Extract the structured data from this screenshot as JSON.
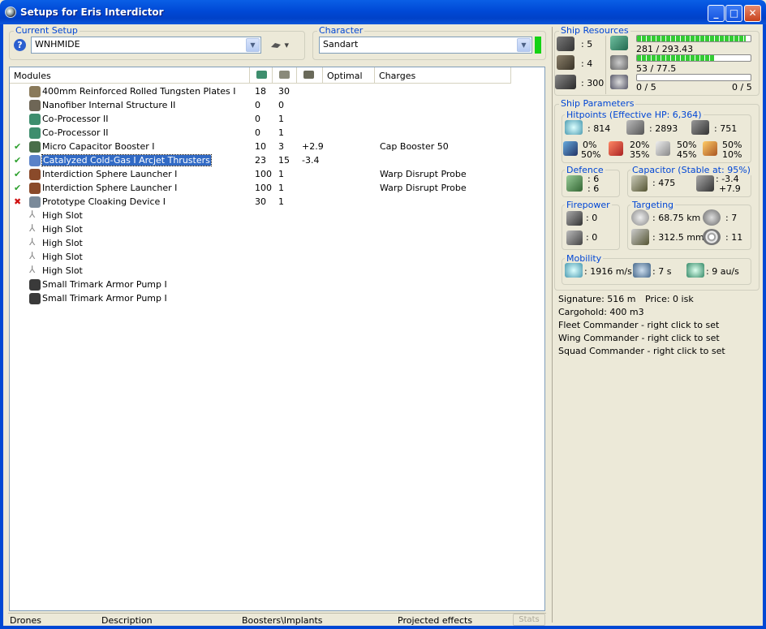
{
  "window": {
    "title": "Setups for Eris Interdictor",
    "buttons": {
      "minimize": "_",
      "maximize": "□",
      "close": "✕"
    }
  },
  "current_setup": {
    "caption": "Current Setup",
    "value": "WNHMIDE",
    "ship_menu_label": "▾"
  },
  "character": {
    "caption": "Character",
    "value": "Sandart",
    "status_color": "#14D214"
  },
  "modules_table": {
    "headers": {
      "modules": "Modules",
      "optimal": "Optimal",
      "charges": "Charges"
    },
    "rows": [
      {
        "status": "",
        "name": "400mm Reinforced Rolled Tungsten Plates I",
        "cpu": "18",
        "pg": "30",
        "cap": "",
        "charge": "",
        "color": "#8A7A5A"
      },
      {
        "status": "",
        "name": "Nanofiber Internal Structure II",
        "cpu": "0",
        "pg": "0",
        "cap": "",
        "charge": "",
        "color": "#6E6656"
      },
      {
        "status": "",
        "name": "Co-Processor II",
        "cpu": "0",
        "pg": "1",
        "cap": "",
        "charge": "",
        "color": "#3E8E6E"
      },
      {
        "status": "",
        "name": "Co-Processor II",
        "cpu": "0",
        "pg": "1",
        "cap": "",
        "charge": "",
        "color": "#3E8E6E"
      },
      {
        "status": "✔",
        "name": "Micro Capacitor Booster I",
        "cpu": "10",
        "pg": "3",
        "cap": "+2.9",
        "charge": "Cap Booster 50",
        "color": "#4A6E4A"
      },
      {
        "status": "✔",
        "name": "Catalyzed Cold-Gas I Arcjet Thrusters",
        "cpu": "23",
        "pg": "15",
        "cap": "-3.4",
        "charge": "",
        "color": "#5A82C8",
        "selected": true
      },
      {
        "status": "✔",
        "name": "Interdiction Sphere Launcher I",
        "cpu": "100",
        "pg": "1",
        "cap": "",
        "charge": "Warp Disrupt Probe",
        "color": "#8A4A2A"
      },
      {
        "status": "✔",
        "name": "Interdiction Sphere Launcher I",
        "cpu": "100",
        "pg": "1",
        "cap": "",
        "charge": "Warp Disrupt Probe",
        "color": "#8A4A2A"
      },
      {
        "status": "✖",
        "name": "Prototype Cloaking Device I",
        "cpu": "30",
        "pg": "1",
        "cap": "",
        "charge": "",
        "color": "#7A8A9A"
      },
      {
        "status": "",
        "name": "High Slot",
        "cpu": "",
        "pg": "",
        "cap": "",
        "charge": "",
        "color": "#B0B0B0",
        "empty": true
      },
      {
        "status": "",
        "name": "High Slot",
        "cpu": "",
        "pg": "",
        "cap": "",
        "charge": "",
        "color": "#B0B0B0",
        "empty": true
      },
      {
        "status": "",
        "name": "High Slot",
        "cpu": "",
        "pg": "",
        "cap": "",
        "charge": "",
        "color": "#B0B0B0",
        "empty": true
      },
      {
        "status": "",
        "name": "High Slot",
        "cpu": "",
        "pg": "",
        "cap": "",
        "charge": "",
        "color": "#B0B0B0",
        "empty": true
      },
      {
        "status": "",
        "name": "High Slot",
        "cpu": "",
        "pg": "",
        "cap": "",
        "charge": "",
        "color": "#B0B0B0",
        "empty": true
      },
      {
        "status": "",
        "name": "Small Trimark Armor Pump I",
        "cpu": "",
        "pg": "",
        "cap": "",
        "charge": "",
        "color": "#3A3A3A"
      },
      {
        "status": "",
        "name": "Small Trimark Armor Pump I",
        "cpu": "",
        "pg": "",
        "cap": "",
        "charge": "",
        "color": "#3A3A3A"
      }
    ]
  },
  "bottom_tabs": {
    "drones": "Drones",
    "description": "Description",
    "boosters": "Boosters\\Implants",
    "projected": "Projected effects",
    "stats": "Stats"
  },
  "ship_resources": {
    "caption": "Ship Resources",
    "turrets": ": 5",
    "launchers": ": 4",
    "calibration": ": 300",
    "cpu_text": "281 / 293.43",
    "cpu_fraction": 0.958,
    "powergrid_text": "53 / 77.5",
    "powergrid_fraction": 0.684,
    "drone_bandwidth_fraction": 0,
    "drone_bay_left": "0 / 5",
    "drone_bay_right": "0 / 5"
  },
  "ship_parameters": {
    "caption": "Ship Parameters",
    "hitpoints": {
      "caption": "Hitpoints (Effective HP: 6,364)",
      "shield": ": 814",
      "armor": ": 2893",
      "structure": ": 751",
      "resists": [
        {
          "a": "0%",
          "b": "50%"
        },
        {
          "a": "20%",
          "b": "35%"
        },
        {
          "a": "50%",
          "b": "45%"
        },
        {
          "a": "50%",
          "b": "10%"
        }
      ]
    },
    "defence": {
      "caption": "Defence",
      "line1": ": 6",
      "line2": ": 6"
    },
    "capacitor": {
      "caption": "Capacitor (Stable at: 95%)",
      "amount": ": 475",
      "delta1": ": -3.4",
      "delta2": "+7.9"
    },
    "firepower": {
      "caption": "Firepower",
      "line1": ": 0",
      "line2": ": 0"
    },
    "targeting": {
      "caption": "Targeting",
      "range": ": 68.75 km",
      "max_targets": ": 7",
      "scan_res": ": 312.5 mm",
      "sensor": ": 11"
    },
    "mobility": {
      "caption": "Mobility",
      "speed": ": 1916 m/s",
      "align": ": 7 s",
      "warp": ": 9 au/s"
    }
  },
  "info": {
    "signature": "Signature: 516 m",
    "price": "Price: 0 isk",
    "cargohold": "Cargohold: 400 m3",
    "fleet": "Fleet Commander - right click to set",
    "wing": "Wing Commander - right click to set",
    "squad": "Squad Commander - right click to set"
  }
}
